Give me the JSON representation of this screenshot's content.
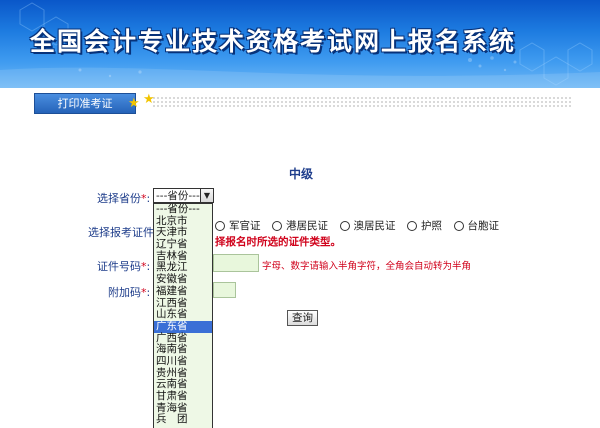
{
  "header": {
    "title": "全国会计专业技术资格考试网上报名系统"
  },
  "tabs": [
    {
      "label": "打印准考证"
    }
  ],
  "form": {
    "level_title": "中级",
    "province_label": "选择省份",
    "id_type_label": "选择报考证件类型",
    "id_number_label": "证件号码",
    "extra_code_label": "附加码",
    "required_mark": "*",
    "colon": ":",
    "province_select": {
      "current": "---省份---",
      "options": [
        "---省份---",
        "北京市",
        "天津市",
        "辽宁省",
        "吉林省",
        "黑龙江",
        "安徽省",
        "福建省",
        "江西省",
        "山东省",
        "广东省",
        "广西省",
        "海南省",
        "四川省",
        "贵州省",
        "云南省",
        "甘肃省",
        "青海省",
        "兵　团"
      ],
      "highlighted": "广东省"
    },
    "id_type_options": [
      "军官证",
      "港居民证",
      "澳居民证",
      "护照",
      "台胞证"
    ],
    "warning": "择报名时所选的证件类型。",
    "id_hint": "字母、数字请输入半角字符，全角会自动转为半角",
    "query_button": "查询"
  },
  "colors": {
    "banner": "#1d7be0",
    "label": "#1d3c8a",
    "warning": "#d0021b",
    "dropdown_bg": "#eef8e6",
    "highlight": "#3a6fd6"
  }
}
